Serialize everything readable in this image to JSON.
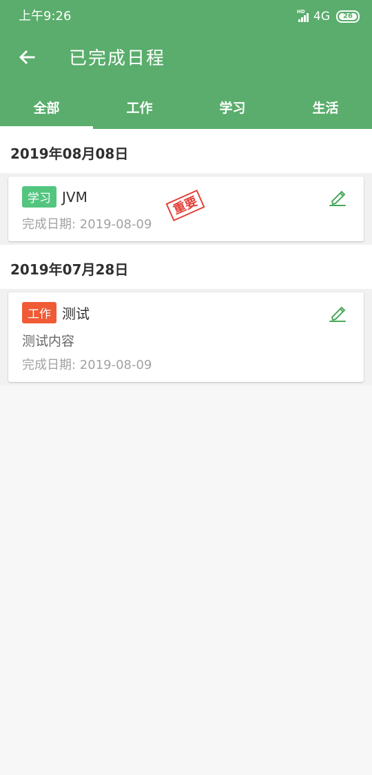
{
  "status": {
    "time": "上午9:26",
    "network": "4G",
    "battery": "26"
  },
  "header": {
    "title": "已完成日程"
  },
  "tabs": [
    {
      "label": "全部",
      "active": true
    },
    {
      "label": "工作",
      "active": false
    },
    {
      "label": "学习",
      "active": false
    },
    {
      "label": "生活",
      "active": false
    }
  ],
  "groups": [
    {
      "date": "2019年08月08日",
      "items": [
        {
          "category": "学习",
          "category_color": "#53c57f",
          "title": "JVM",
          "content": "",
          "completed": "完成日期: 2019-08-09",
          "stamp": "重要",
          "stamp_color": "#e34038"
        }
      ]
    },
    {
      "date": "2019年07月28日",
      "items": [
        {
          "category": "工作",
          "category_color": "#f05a35",
          "title": "测试",
          "content": "测试内容",
          "completed": "完成日期: 2019-08-09"
        }
      ]
    }
  ],
  "icons": {
    "back": "back-arrow-icon",
    "edit": "edit-pencil-icon"
  },
  "colors": {
    "primary": "#5aad6c",
    "background": "#f7f7f7"
  }
}
